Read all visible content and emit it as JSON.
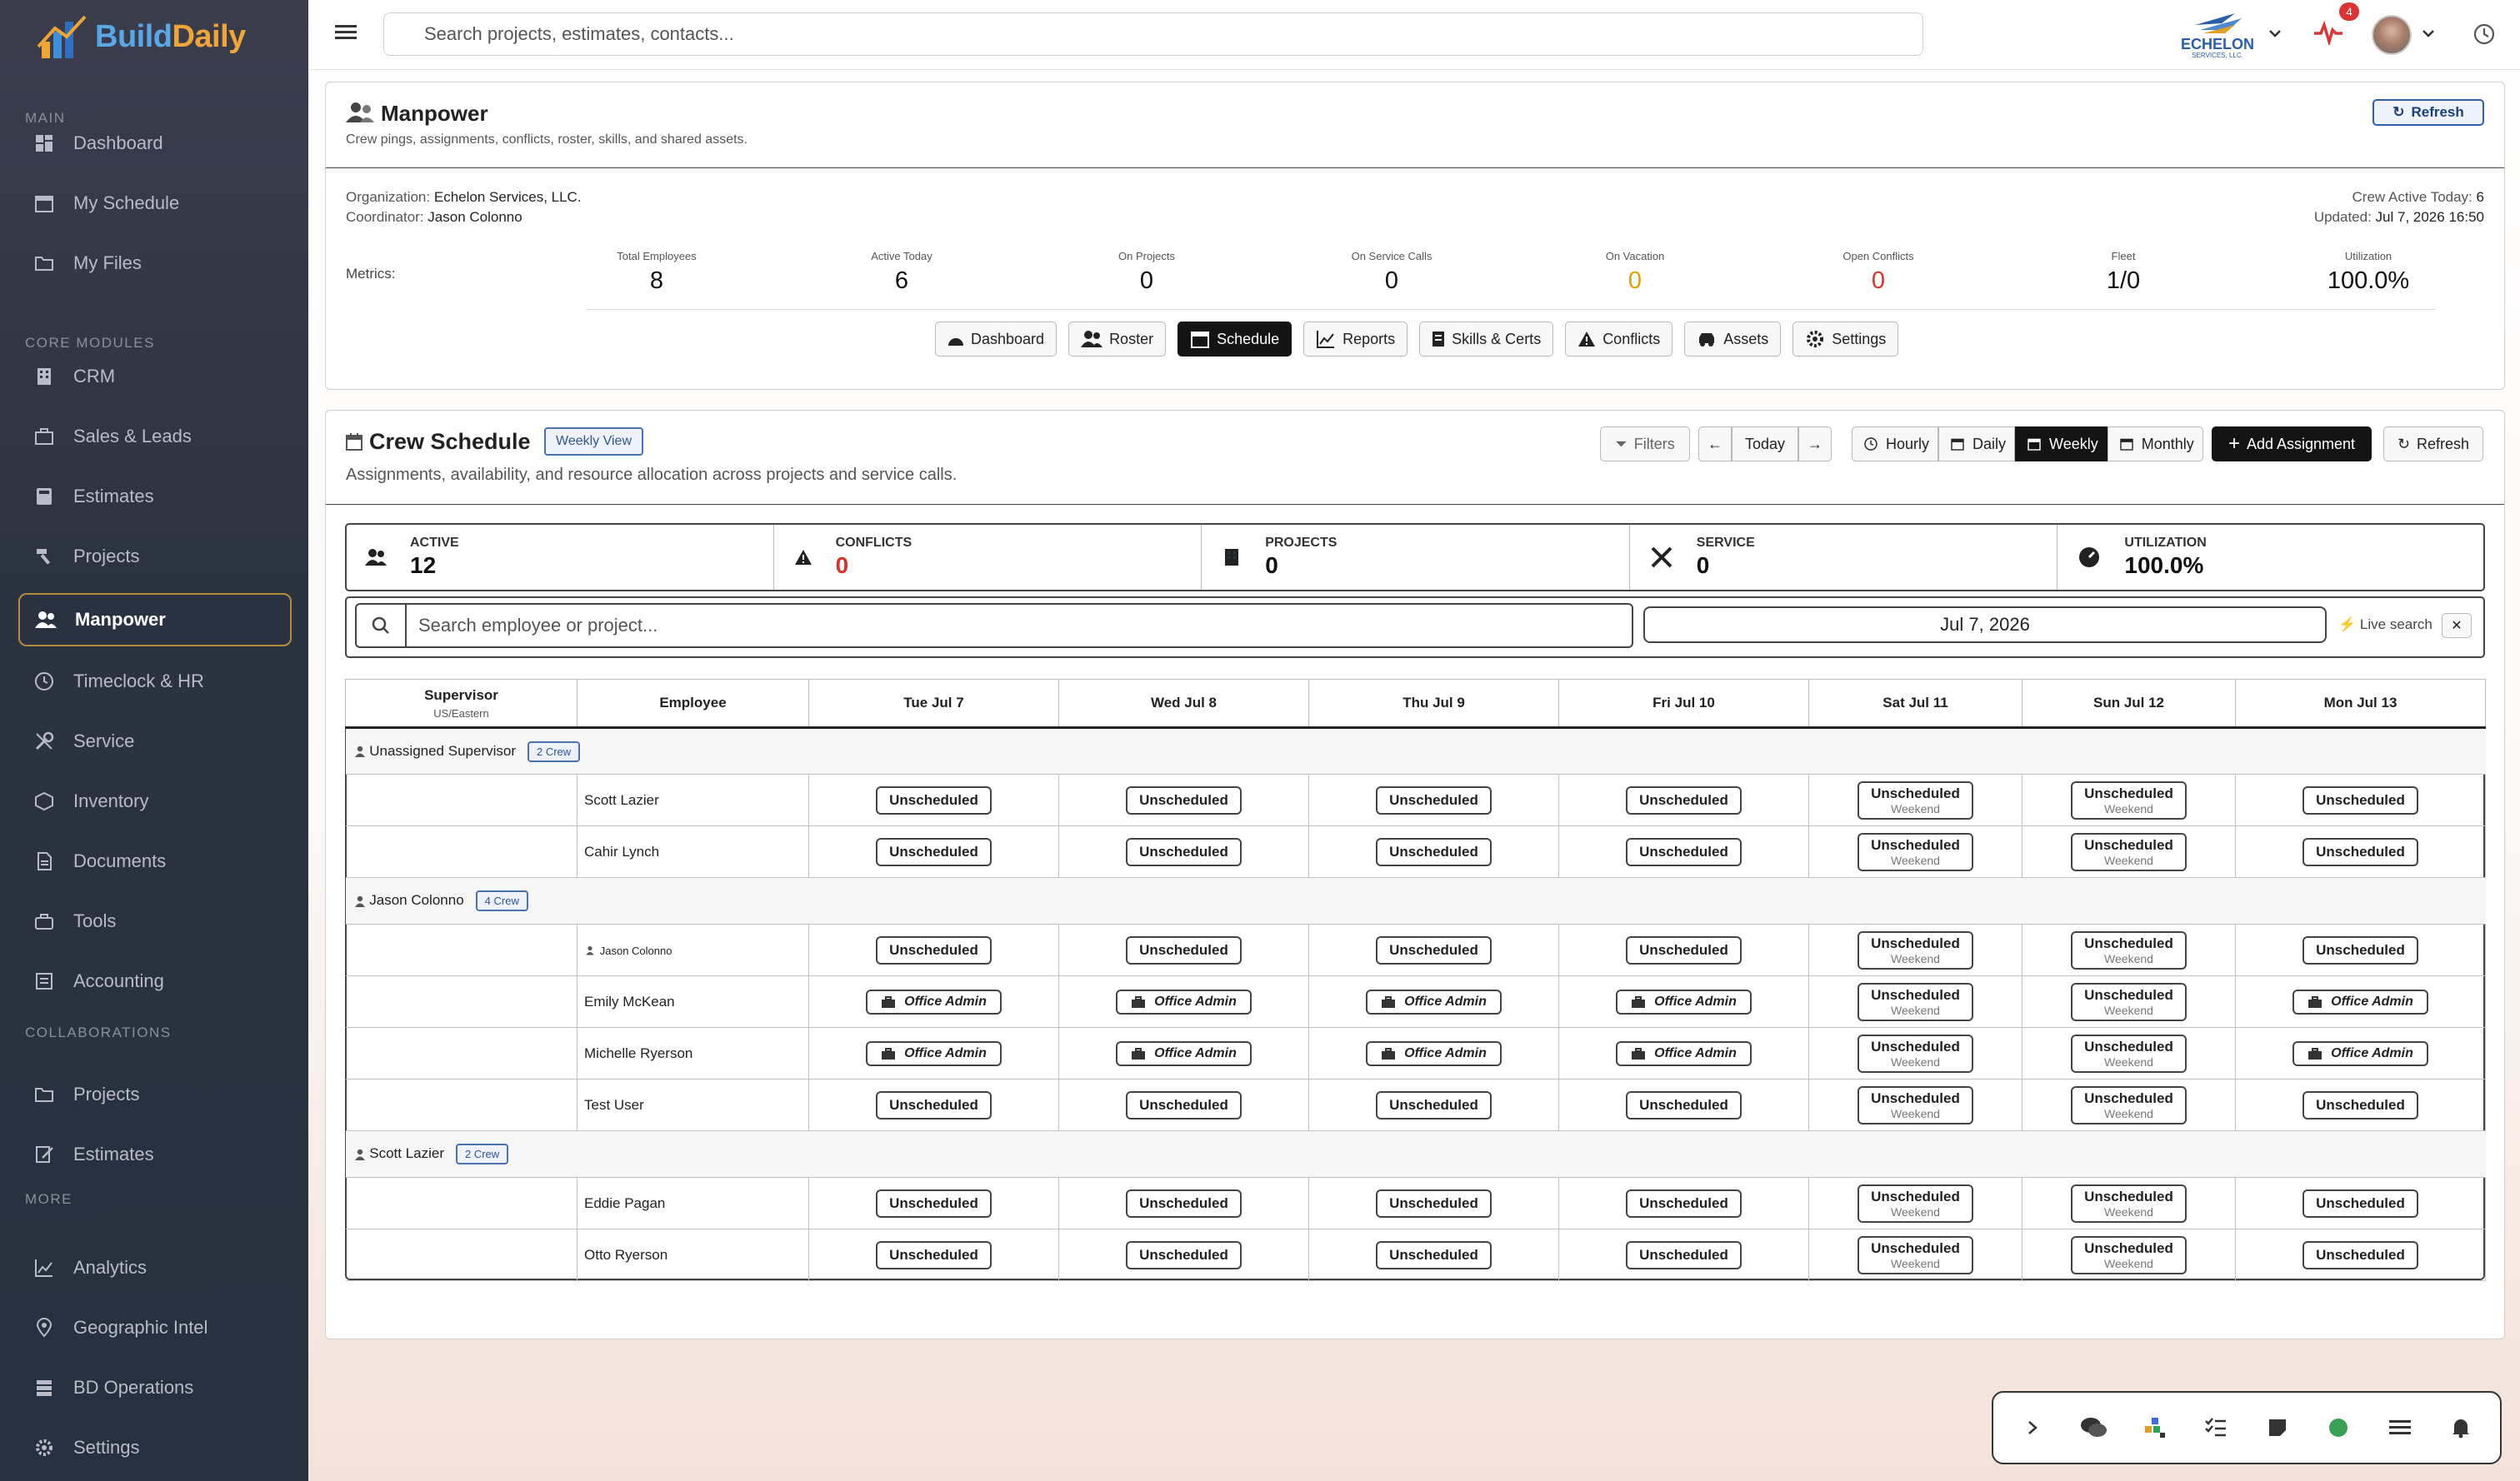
{
  "brand": {
    "name_part1": "Build",
    "name_part2": "Daily"
  },
  "sidebar": {
    "sections": [
      {
        "title": "MAIN"
      },
      {
        "title": "CORE MODULES"
      },
      {
        "title": "COLLABORATIONS"
      },
      {
        "title": "MORE"
      }
    ],
    "items": [
      {
        "label": "Dashboard",
        "icon": "grid-icon"
      },
      {
        "label": "My Schedule",
        "icon": "calendar-icon"
      },
      {
        "label": "My Files",
        "icon": "folder-icon"
      },
      {
        "label": "CRM",
        "icon": "building-icon"
      },
      {
        "label": "Sales & Leads",
        "icon": "briefcase-icon"
      },
      {
        "label": "Estimates",
        "icon": "calculator-icon"
      },
      {
        "label": "Projects",
        "icon": "hammer-icon"
      },
      {
        "label": "Manpower",
        "icon": "users-icon"
      },
      {
        "label": "Timeclock & HR",
        "icon": "clock-icon"
      },
      {
        "label": "Service",
        "icon": "wrench-icon"
      },
      {
        "label": "Inventory",
        "icon": "box-icon"
      },
      {
        "label": "Documents",
        "icon": "document-icon"
      },
      {
        "label": "Tools",
        "icon": "toolbox-icon"
      },
      {
        "label": "Accounting",
        "icon": "ledger-icon"
      },
      {
        "label": "Projects",
        "icon": "folder-icon"
      },
      {
        "label": "Estimates",
        "icon": "edit-icon"
      },
      {
        "label": "Analytics",
        "icon": "chart-icon"
      },
      {
        "label": "Geographic Intel",
        "icon": "map-pin-icon"
      },
      {
        "label": "BD Operations",
        "icon": "database-icon"
      },
      {
        "label": "Settings",
        "icon": "gear-icon"
      }
    ]
  },
  "topbar": {
    "search_placeholder": "Search projects, estimates, contacts...",
    "company_logo_text": "ECHELON",
    "company_logo_sub": "SERVICES, LLC.",
    "notification_count": "4"
  },
  "manpower": {
    "title": "Manpower",
    "subtitle": "Crew pings, assignments, conflicts, roster, skills, and shared assets.",
    "refresh_label": "Refresh",
    "org_label": "Organization:",
    "org_value": "Echelon Services, LLC.",
    "coord_label": "Coordinator:",
    "coord_value": "Jason Colonno",
    "crew_active_label": "Crew Active Today:",
    "crew_active_value": "6",
    "updated_label": "Updated:",
    "updated_value": "Jul 7, 2026 16:50",
    "metrics_label": "Metrics:",
    "metrics": [
      {
        "label": "Total Employees",
        "value": "8",
        "color": "#111111"
      },
      {
        "label": "Active Today",
        "value": "6",
        "color": "#111111"
      },
      {
        "label": "On Projects",
        "value": "0",
        "color": "#111111"
      },
      {
        "label": "On Service Calls",
        "value": "0",
        "color": "#111111"
      },
      {
        "label": "On Vacation",
        "value": "0",
        "color": "#e0a100"
      },
      {
        "label": "Open Conflicts",
        "value": "0",
        "color": "#d9332b"
      },
      {
        "label": "Fleet",
        "value": "1/0",
        "color": "#111111"
      },
      {
        "label": "Utilization",
        "value": "100.0%",
        "color": "#111111"
      }
    ],
    "tabs": [
      {
        "label": "Dashboard",
        "icon": "dashboard-icon"
      },
      {
        "label": "Roster",
        "icon": "users-icon"
      },
      {
        "label": "Schedule",
        "icon": "calendar-icon"
      },
      {
        "label": "Reports",
        "icon": "chart-icon"
      },
      {
        "label": "Skills & Certs",
        "icon": "id-card-icon"
      },
      {
        "label": "Conflicts",
        "icon": "warning-icon"
      },
      {
        "label": "Assets",
        "icon": "truck-icon"
      },
      {
        "label": "Settings",
        "icon": "gear-icon"
      }
    ],
    "active_tab": "Schedule"
  },
  "crew_schedule": {
    "title": "Crew Schedule",
    "view_badge": "Weekly View",
    "subtitle": "Assignments, availability, and resource allocation across projects and service calls.",
    "filters_label": "Filters",
    "today_label": "Today",
    "view_buttons": [
      "Hourly",
      "Daily",
      "Weekly",
      "Monthly"
    ],
    "active_view": "Weekly",
    "add_assignment_label": "Add Assignment",
    "refresh_label": "Refresh",
    "stats": [
      {
        "label": "ACTIVE",
        "value": "12",
        "icon": "users-icon",
        "color": "#111111"
      },
      {
        "label": "CONFLICTS",
        "value": "0",
        "icon": "warning-icon",
        "color": "#d9332b"
      },
      {
        "label": "PROJECTS",
        "value": "0",
        "icon": "building-icon",
        "color": "#111111"
      },
      {
        "label": "SERVICE",
        "value": "0",
        "icon": "tools-icon",
        "color": "#111111"
      },
      {
        "label": "UTILIZATION",
        "value": "100.0%",
        "icon": "gauge-icon",
        "color": "#111111"
      }
    ],
    "search_placeholder": "Search employee or project...",
    "date_value": "Jul 7, 2026",
    "live_search_label": "Live search",
    "columns": {
      "supervisor": "Supervisor",
      "supervisor_tz": "US/Eastern",
      "employee": "Employee",
      "days": [
        "Tue Jul 7",
        "Wed Jul 8",
        "Thu Jul 9",
        "Fri Jul 10",
        "Sat Jul 11",
        "Sun Jul 12",
        "Mon Jul 13"
      ]
    },
    "unscheduled_label": "Unscheduled",
    "weekend_label": "Weekend",
    "office_admin_label": "Office Admin",
    "groups": [
      {
        "supervisor": "Unassigned Supervisor",
        "badge": "2 Crew",
        "rows": [
          {
            "employee": "Scott Lazier",
            "small": false,
            "cells": [
              "U",
              "U",
              "U",
              "U",
              "W",
              "W",
              "U"
            ]
          },
          {
            "employee": "Cahir Lynch",
            "small": false,
            "cells": [
              "U",
              "U",
              "U",
              "U",
              "W",
              "W",
              "U"
            ]
          }
        ]
      },
      {
        "supervisor": "Jason Colonno",
        "badge": "4 Crew",
        "rows": [
          {
            "employee": "Jason Colonno",
            "small": true,
            "cells": [
              "U",
              "U",
              "U",
              "U",
              "W",
              "W",
              "U"
            ]
          },
          {
            "employee": "Emily McKean",
            "small": false,
            "cells": [
              "O",
              "O",
              "O",
              "O",
              "W",
              "W",
              "O"
            ]
          },
          {
            "employee": "Michelle Ryerson",
            "small": false,
            "cells": [
              "O",
              "O",
              "O",
              "O",
              "W",
              "W",
              "O"
            ]
          },
          {
            "employee": "Test User",
            "small": false,
            "cells": [
              "U",
              "U",
              "U",
              "U",
              "W",
              "W",
              "U"
            ]
          }
        ]
      },
      {
        "supervisor": "Scott Lazier",
        "badge": "2 Crew",
        "rows": [
          {
            "employee": "Eddie Pagan",
            "small": false,
            "cells": [
              "U",
              "U",
              "U",
              "U",
              "W",
              "W",
              "U"
            ]
          },
          {
            "employee": "Otto Ryerson",
            "small": false,
            "cells": [
              "U",
              "U",
              "U",
              "U",
              "W",
              "W",
              "U"
            ]
          }
        ]
      }
    ]
  },
  "dock": {
    "icons": [
      "chevron-right-icon",
      "chat-icon",
      "apps-icon",
      "checklist-icon",
      "note-icon",
      "status-dot-icon",
      "menu-icon",
      "bell-icon"
    ]
  }
}
